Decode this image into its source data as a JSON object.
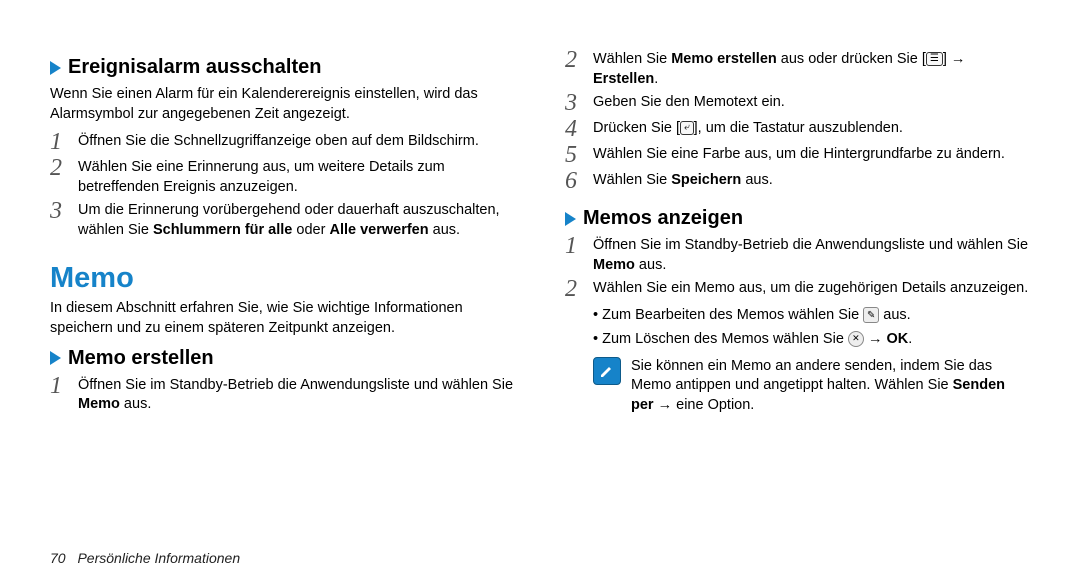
{
  "left": {
    "sub1_title": "Ereignisalarm ausschalten",
    "sub1_intro": "Wenn Sie einen Alarm für ein Kalenderereignis einstellen, wird das Alarmsymbol zur angegebenen Zeit angezeigt.",
    "sub1_steps": [
      "Öffnen Sie die Schnellzugriffanzeige oben auf dem Bildschirm.",
      "Wählen Sie eine Erinnerung aus, um weitere Details zum betreffenden Ereignis anzuzeigen."
    ],
    "sub1_step3_a": "Um die Erinnerung vorübergehend oder dauerhaft auszuschalten, wählen Sie ",
    "sub1_step3_b": "Schlummern für alle",
    "sub1_step3_c": " oder ",
    "sub1_step3_d": "Alle verwerfen",
    "sub1_step3_e": " aus.",
    "section_title": "Memo",
    "section_intro": "In diesem Abschnitt erfahren Sie, wie Sie wichtige Informationen speichern und zu einem späteren Zeitpunkt anzeigen.",
    "sub2_title": "Memo erstellen",
    "sub2_step1_a": "Öffnen Sie im Standby-Betrieb die Anwendungsliste und wählen Sie ",
    "sub2_step1_b": "Memo",
    "sub2_step1_c": " aus."
  },
  "right": {
    "step2_a": "Wählen Sie ",
    "step2_b": "Memo erstellen",
    "step2_c": " aus oder drücken Sie [",
    "step2_d": "] → ",
    "step2_e": "Erstellen",
    "step2_f": ".",
    "step3": "Geben Sie den Memotext ein.",
    "step4_a": "Drücken Sie [",
    "step4_b": "], um die Tastatur auszublenden.",
    "step5": "Wählen Sie eine Farbe aus, um die Hintergrundfarbe zu ändern.",
    "step6_a": "Wählen Sie ",
    "step6_b": "Speichern",
    "step6_c": " aus.",
    "sub_title": "Memos anzeigen",
    "mstep1_a": "Öffnen Sie im Standby-Betrieb die Anwendungsliste und wählen Sie ",
    "mstep1_b": "Memo",
    "mstep1_c": " aus.",
    "mstep2": "Wählen Sie ein Memo aus, um die zugehörigen Details anzuzeigen.",
    "bullet1_a": "Zum Bearbeiten des Memos wählen Sie ",
    "bullet1_b": " aus.",
    "bullet2_a": "Zum Löschen des Memos wählen Sie ",
    "bullet2_b": " → ",
    "bullet2_c": "OK",
    "bullet2_d": ".",
    "note_a": "Sie können ein Memo an andere senden, indem Sie das Memo antippen und angetippt halten. Wählen Sie ",
    "note_b": "Senden per",
    "note_c": " → eine Option."
  },
  "footer": {
    "page": "70",
    "section": "Persönliche Informationen"
  }
}
